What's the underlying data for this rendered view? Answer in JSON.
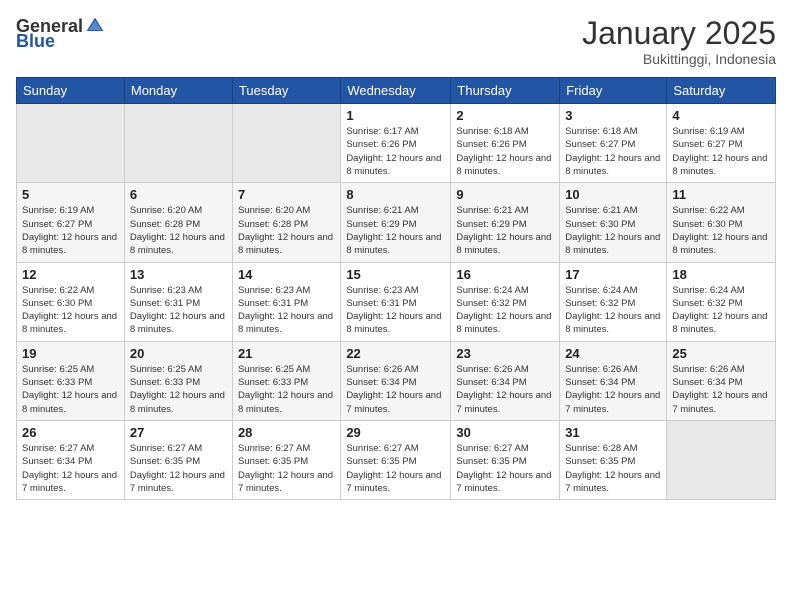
{
  "logo": {
    "general": "General",
    "blue": "Blue"
  },
  "title": {
    "month_year": "January 2025",
    "location": "Bukittinggi, Indonesia"
  },
  "headers": [
    "Sunday",
    "Monday",
    "Tuesday",
    "Wednesday",
    "Thursday",
    "Friday",
    "Saturday"
  ],
  "weeks": [
    [
      {
        "day": "",
        "sunrise": "",
        "sunset": "",
        "daylight": ""
      },
      {
        "day": "",
        "sunrise": "",
        "sunset": "",
        "daylight": ""
      },
      {
        "day": "",
        "sunrise": "",
        "sunset": "",
        "daylight": ""
      },
      {
        "day": "1",
        "sunrise": "Sunrise: 6:17 AM",
        "sunset": "Sunset: 6:26 PM",
        "daylight": "Daylight: 12 hours and 8 minutes."
      },
      {
        "day": "2",
        "sunrise": "Sunrise: 6:18 AM",
        "sunset": "Sunset: 6:26 PM",
        "daylight": "Daylight: 12 hours and 8 minutes."
      },
      {
        "day": "3",
        "sunrise": "Sunrise: 6:18 AM",
        "sunset": "Sunset: 6:27 PM",
        "daylight": "Daylight: 12 hours and 8 minutes."
      },
      {
        "day": "4",
        "sunrise": "Sunrise: 6:19 AM",
        "sunset": "Sunset: 6:27 PM",
        "daylight": "Daylight: 12 hours and 8 minutes."
      }
    ],
    [
      {
        "day": "5",
        "sunrise": "Sunrise: 6:19 AM",
        "sunset": "Sunset: 6:27 PM",
        "daylight": "Daylight: 12 hours and 8 minutes."
      },
      {
        "day": "6",
        "sunrise": "Sunrise: 6:20 AM",
        "sunset": "Sunset: 6:28 PM",
        "daylight": "Daylight: 12 hours and 8 minutes."
      },
      {
        "day": "7",
        "sunrise": "Sunrise: 6:20 AM",
        "sunset": "Sunset: 6:28 PM",
        "daylight": "Daylight: 12 hours and 8 minutes."
      },
      {
        "day": "8",
        "sunrise": "Sunrise: 6:21 AM",
        "sunset": "Sunset: 6:29 PM",
        "daylight": "Daylight: 12 hours and 8 minutes."
      },
      {
        "day": "9",
        "sunrise": "Sunrise: 6:21 AM",
        "sunset": "Sunset: 6:29 PM",
        "daylight": "Daylight: 12 hours and 8 minutes."
      },
      {
        "day": "10",
        "sunrise": "Sunrise: 6:21 AM",
        "sunset": "Sunset: 6:30 PM",
        "daylight": "Daylight: 12 hours and 8 minutes."
      },
      {
        "day": "11",
        "sunrise": "Sunrise: 6:22 AM",
        "sunset": "Sunset: 6:30 PM",
        "daylight": "Daylight: 12 hours and 8 minutes."
      }
    ],
    [
      {
        "day": "12",
        "sunrise": "Sunrise: 6:22 AM",
        "sunset": "Sunset: 6:30 PM",
        "daylight": "Daylight: 12 hours and 8 minutes."
      },
      {
        "day": "13",
        "sunrise": "Sunrise: 6:23 AM",
        "sunset": "Sunset: 6:31 PM",
        "daylight": "Daylight: 12 hours and 8 minutes."
      },
      {
        "day": "14",
        "sunrise": "Sunrise: 6:23 AM",
        "sunset": "Sunset: 6:31 PM",
        "daylight": "Daylight: 12 hours and 8 minutes."
      },
      {
        "day": "15",
        "sunrise": "Sunrise: 6:23 AM",
        "sunset": "Sunset: 6:31 PM",
        "daylight": "Daylight: 12 hours and 8 minutes."
      },
      {
        "day": "16",
        "sunrise": "Sunrise: 6:24 AM",
        "sunset": "Sunset: 6:32 PM",
        "daylight": "Daylight: 12 hours and 8 minutes."
      },
      {
        "day": "17",
        "sunrise": "Sunrise: 6:24 AM",
        "sunset": "Sunset: 6:32 PM",
        "daylight": "Daylight: 12 hours and 8 minutes."
      },
      {
        "day": "18",
        "sunrise": "Sunrise: 6:24 AM",
        "sunset": "Sunset: 6:32 PM",
        "daylight": "Daylight: 12 hours and 8 minutes."
      }
    ],
    [
      {
        "day": "19",
        "sunrise": "Sunrise: 6:25 AM",
        "sunset": "Sunset: 6:33 PM",
        "daylight": "Daylight: 12 hours and 8 minutes."
      },
      {
        "day": "20",
        "sunrise": "Sunrise: 6:25 AM",
        "sunset": "Sunset: 6:33 PM",
        "daylight": "Daylight: 12 hours and 8 minutes."
      },
      {
        "day": "21",
        "sunrise": "Sunrise: 6:25 AM",
        "sunset": "Sunset: 6:33 PM",
        "daylight": "Daylight: 12 hours and 8 minutes."
      },
      {
        "day": "22",
        "sunrise": "Sunrise: 6:26 AM",
        "sunset": "Sunset: 6:34 PM",
        "daylight": "Daylight: 12 hours and 7 minutes."
      },
      {
        "day": "23",
        "sunrise": "Sunrise: 6:26 AM",
        "sunset": "Sunset: 6:34 PM",
        "daylight": "Daylight: 12 hours and 7 minutes."
      },
      {
        "day": "24",
        "sunrise": "Sunrise: 6:26 AM",
        "sunset": "Sunset: 6:34 PM",
        "daylight": "Daylight: 12 hours and 7 minutes."
      },
      {
        "day": "25",
        "sunrise": "Sunrise: 6:26 AM",
        "sunset": "Sunset: 6:34 PM",
        "daylight": "Daylight: 12 hours and 7 minutes."
      }
    ],
    [
      {
        "day": "26",
        "sunrise": "Sunrise: 6:27 AM",
        "sunset": "Sunset: 6:34 PM",
        "daylight": "Daylight: 12 hours and 7 minutes."
      },
      {
        "day": "27",
        "sunrise": "Sunrise: 6:27 AM",
        "sunset": "Sunset: 6:35 PM",
        "daylight": "Daylight: 12 hours and 7 minutes."
      },
      {
        "day": "28",
        "sunrise": "Sunrise: 6:27 AM",
        "sunset": "Sunset: 6:35 PM",
        "daylight": "Daylight: 12 hours and 7 minutes."
      },
      {
        "day": "29",
        "sunrise": "Sunrise: 6:27 AM",
        "sunset": "Sunset: 6:35 PM",
        "daylight": "Daylight: 12 hours and 7 minutes."
      },
      {
        "day": "30",
        "sunrise": "Sunrise: 6:27 AM",
        "sunset": "Sunset: 6:35 PM",
        "daylight": "Daylight: 12 hours and 7 minutes."
      },
      {
        "day": "31",
        "sunrise": "Sunrise: 6:28 AM",
        "sunset": "Sunset: 6:35 PM",
        "daylight": "Daylight: 12 hours and 7 minutes."
      },
      {
        "day": "",
        "sunrise": "",
        "sunset": "",
        "daylight": ""
      }
    ]
  ]
}
